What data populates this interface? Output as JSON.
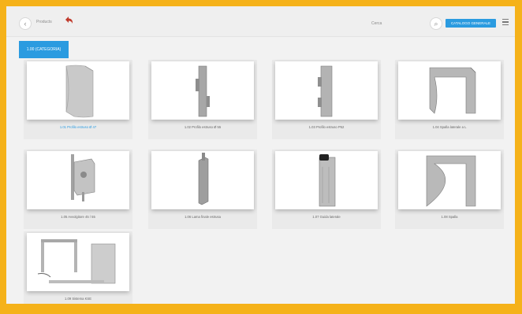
{
  "header": {
    "back_symbol": "‹",
    "breadcrumb": "Products",
    "search_label": "Cerca",
    "search_symbol": "⌕",
    "primary_button": "CATALOGO GENERALE"
  },
  "active_tab": "1.00 (CATEGORIA)",
  "products": [
    {
      "label": "1.01 Profilo estruso Ø 47",
      "highlight": true
    },
    {
      "label": "1.02 Profilo estruso Ø 55",
      "highlight": false
    },
    {
      "label": "1.03 Profilo estruso P52",
      "highlight": false
    },
    {
      "label": "1.04 Spalla laterale a L",
      "highlight": false
    },
    {
      "label": "1.05 Avvolgitore 45 / 55",
      "highlight": false
    },
    {
      "label": "1.06 Lama finale estrusa",
      "highlight": false
    },
    {
      "label": "1.07 Guida laterale",
      "highlight": false
    },
    {
      "label": "1.08 Spalla",
      "highlight": false
    },
    {
      "label": "1.09 Sistema KSE",
      "highlight": false
    }
  ]
}
